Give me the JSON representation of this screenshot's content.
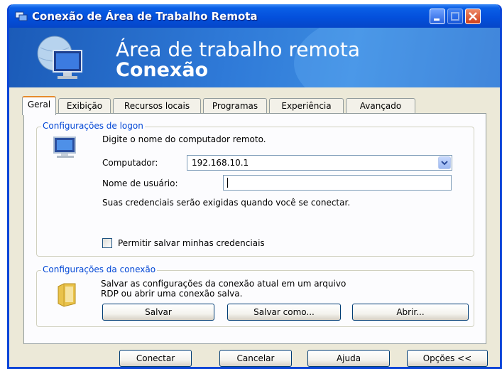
{
  "window": {
    "title": "Conexão de Área de Trabalho Remota"
  },
  "banner": {
    "line1": "Área de trabalho remota",
    "line2": "Conexão"
  },
  "tabs": [
    {
      "label": "Geral",
      "active": true
    },
    {
      "label": "Exibição",
      "active": false
    },
    {
      "label": "Recursos locais",
      "active": false
    },
    {
      "label": "Programas",
      "active": false
    },
    {
      "label": "Experiência",
      "active": false
    },
    {
      "label": "Avançado",
      "active": false
    }
  ],
  "logon": {
    "legend": "Configurações de logon",
    "instruction": "Digite o nome do computador remoto.",
    "computer_label": "Computador:",
    "computer_value": "192.168.10.1",
    "username_label": "Nome de usuário:",
    "username_value": "",
    "credentials_note": "Suas credenciais serão exigidas quando você se conectar.",
    "save_credentials_label": "Permitir salvar minhas credenciais",
    "save_credentials_checked": false
  },
  "connection": {
    "legend": "Configurações da conexão",
    "description_line1": "Salvar as configurações da conexão atual em um arquivo",
    "description_line2": "RDP ou abrir uma conexão salva.",
    "save_label": "Salvar",
    "save_as_label": "Salvar como...",
    "open_label": "Abrir..."
  },
  "footer": {
    "connect_label": "Conectar",
    "cancel_label": "Cancelar",
    "help_label": "Ajuda",
    "options_label": "Opções <<"
  },
  "icons": {
    "title": "remote-desktop-icon",
    "banner": "monitor-globe-icon",
    "logon": "computer-icon",
    "connection": "folder-icon",
    "combo": "chevron-down-icon"
  },
  "colors": {
    "titlebar": "#0450DC",
    "legend": "#0046D5",
    "active_tab_accent": "#E68B2C",
    "close_button": "#D0401B"
  }
}
